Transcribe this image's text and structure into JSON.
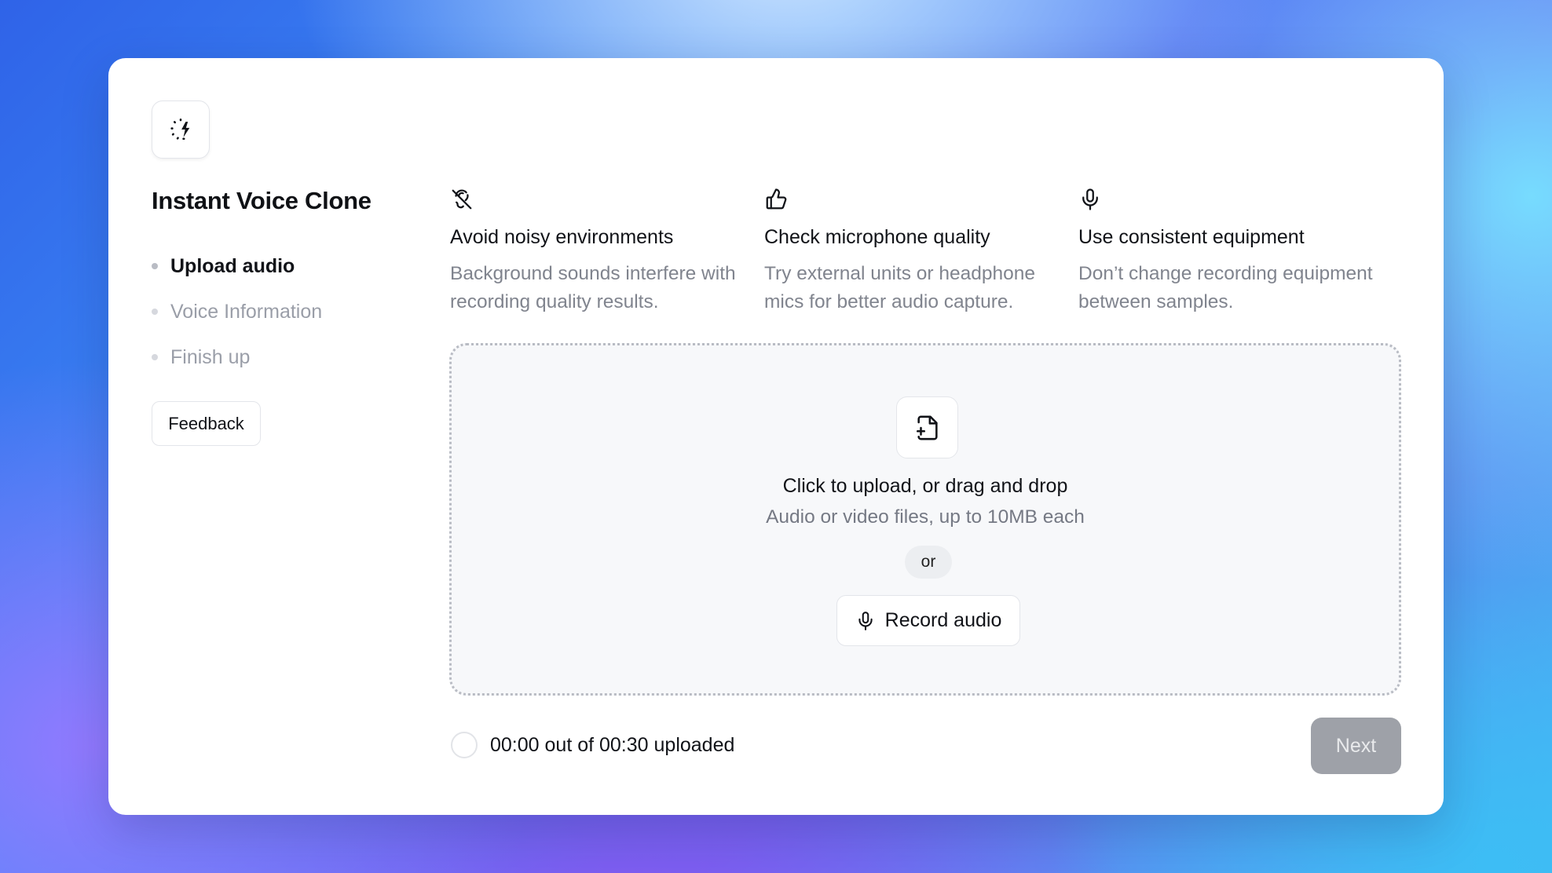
{
  "app": {
    "title": "Instant Voice Clone"
  },
  "steps": [
    {
      "label": "Upload audio",
      "active": true
    },
    {
      "label": "Voice Information",
      "active": false
    },
    {
      "label": "Finish up",
      "active": false
    }
  ],
  "feedback_label": "Feedback",
  "tips": [
    {
      "icon": "ear-off-icon",
      "title": "Avoid noisy environments",
      "description": "Background sounds interfere with recording quality results."
    },
    {
      "icon": "thumbs-up-icon",
      "title": "Check microphone quality",
      "description": "Try external units or headphone mics for better audio capture."
    },
    {
      "icon": "microphone-icon",
      "title": "Use consistent equipment",
      "description": "Don’t change recording equipment between samples."
    }
  ],
  "dropzone": {
    "icon": "file-plus-icon",
    "title": "Click to upload, or drag and drop",
    "subtitle": "Audio or video files, up to 10MB each",
    "divider": "or",
    "record_label": "Record audio"
  },
  "progress": {
    "text": "00:00 out of 00:30 uploaded",
    "fraction": 0
  },
  "next_label": "Next",
  "colors": {
    "primary_text": "#111318",
    "muted_text": "#80848e",
    "next_disabled_bg": "#9ea1a8"
  }
}
